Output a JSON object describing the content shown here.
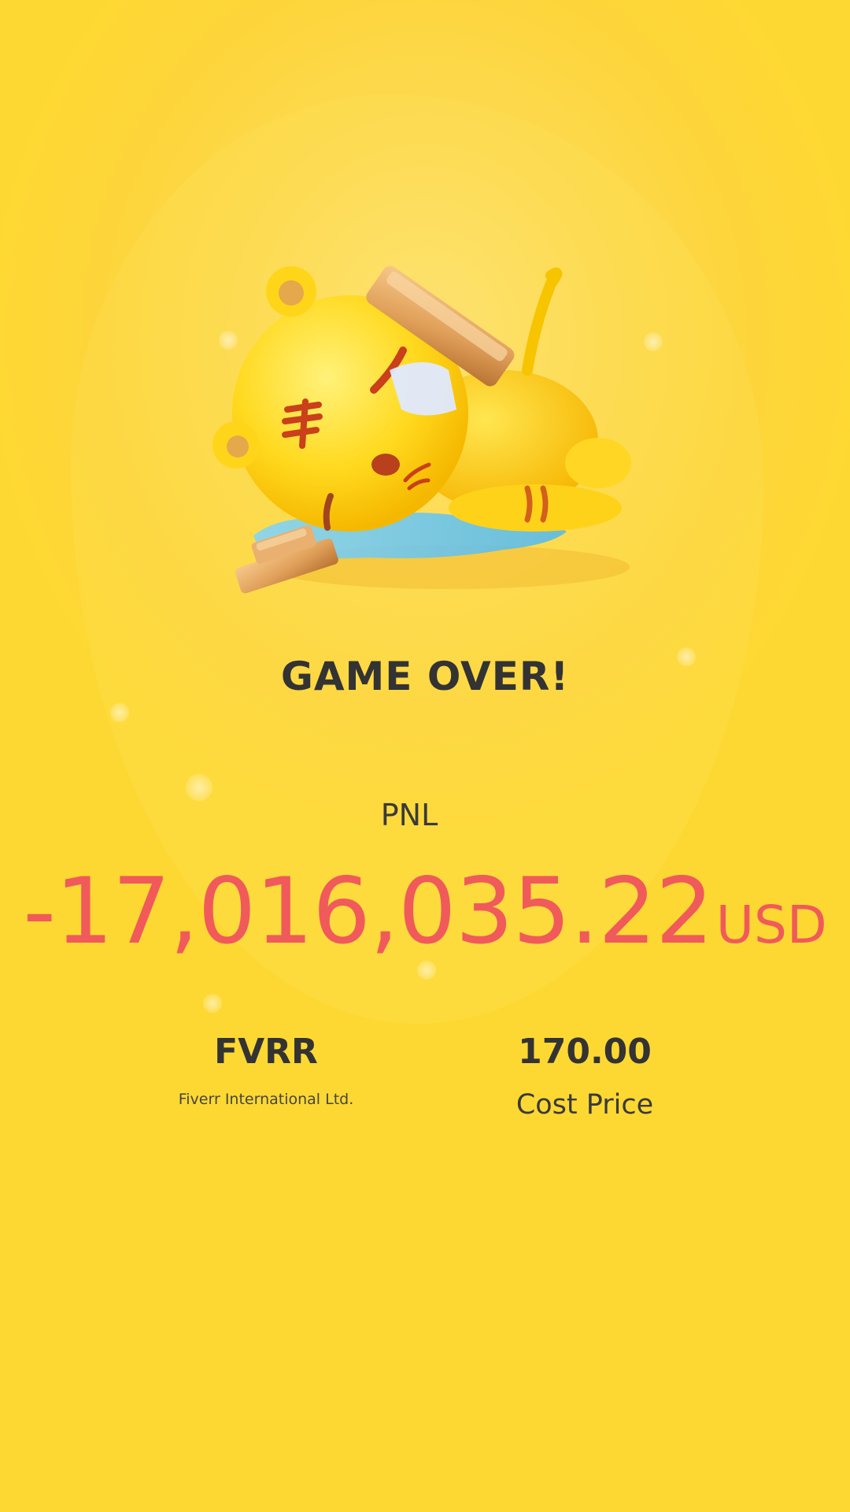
{
  "title": "GAME OVER!",
  "pnl": {
    "label": "PNL",
    "value": "-17,016,035.22",
    "unit": "USD"
  },
  "stock": {
    "ticker": "FVRR",
    "name": "Fiverr International Ltd."
  },
  "cost": {
    "value": "170.00",
    "label": "Cost Price"
  },
  "colors": {
    "background": "#fdd53a",
    "loss": "#f05a5a",
    "text": "#333333"
  }
}
